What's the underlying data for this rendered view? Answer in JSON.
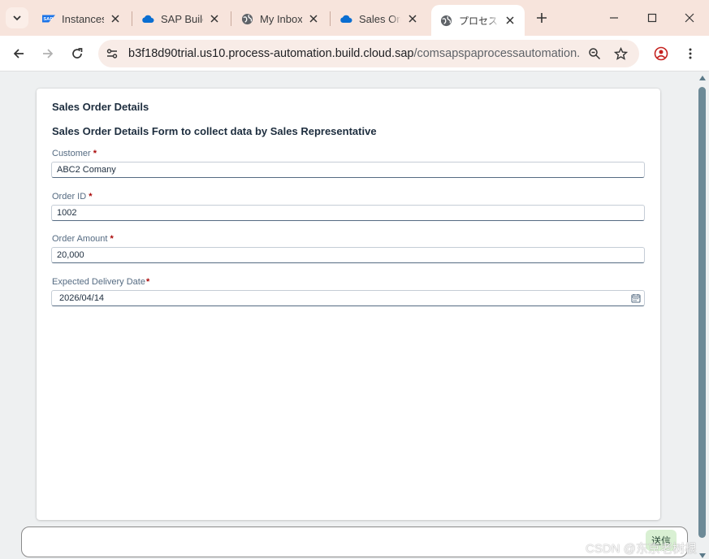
{
  "tabs": [
    {
      "title": "Instances",
      "favicon": "sap-logo-icon",
      "active": false
    },
    {
      "title": "SAP Build",
      "favicon": "cloud-icon",
      "active": false
    },
    {
      "title": "My Inbox",
      "favicon": "globe-icon",
      "active": false
    },
    {
      "title": "Sales Orc",
      "favicon": "cloud-icon",
      "active": false
    },
    {
      "title": "プロセスオ-",
      "favicon": "globe-icon",
      "active": true
    }
  ],
  "sap_logo_text": "SAP",
  "address_bar": {
    "domain": "b3f18d90trial.us10.process-automation.build.cloud.sap",
    "path": "/comsapspaprocessautomation.c..."
  },
  "form": {
    "title": "Sales Order Details",
    "subtitle": "Sales Order Details Form to collect data by Sales Representative",
    "fields": [
      {
        "label": "Customer",
        "required_mark": "*",
        "value": "ABC2 Comany"
      },
      {
        "label": "Order ID",
        "required_mark": "*",
        "value": "1002"
      },
      {
        "label": "Order Amount",
        "required_mark": "*",
        "value": "20,000"
      },
      {
        "label": "Expected Delivery Date",
        "required_mark": "*",
        "value": "2026/04/14"
      }
    ]
  },
  "send_button": "送信",
  "watermark": "CSDN @东京老树根",
  "colors": {
    "accent": "#f7e4dc",
    "required": "#aa0808",
    "scrollbar": "#6d8a97"
  }
}
